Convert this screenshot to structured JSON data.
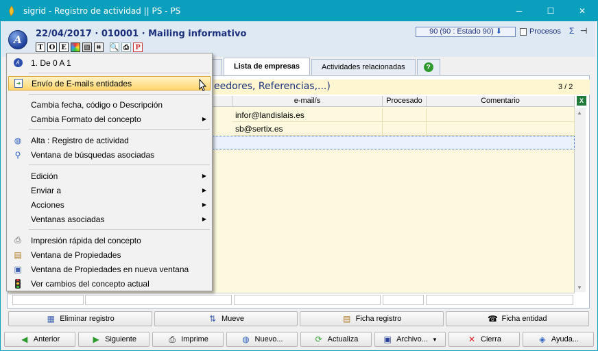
{
  "window": {
    "title": "sigrid - Registro de actividad || PS - PS",
    "controls": {
      "minimize": "─",
      "maximize": "☐",
      "close": "✕"
    }
  },
  "header": {
    "avatar_letter": "A",
    "title": "22/04/2017 · 010001 · Mailing informativo",
    "status": "90 (90 : Estado 90)",
    "procesos": "Procesos",
    "sigma": "Σ",
    "toolbar": [
      "T",
      "O",
      "E"
    ]
  },
  "tabs": [
    {
      "label": "Lista de empresas",
      "active": true
    },
    {
      "label": "Actividades relacionadas",
      "active": false
    },
    {
      "label": "?",
      "active": false
    }
  ],
  "section": {
    "title": "eedores, Referencias,...)",
    "pager": "3 / 2"
  },
  "table": {
    "columns": [
      "e-mail/s",
      "Procesado",
      "Comentario"
    ],
    "rows": [
      {
        "email": "infor@landislais.es",
        "procesado": "",
        "comentario": ""
      },
      {
        "email": "sb@sertix.es",
        "procesado": "",
        "comentario": ""
      }
    ]
  },
  "context_menu": {
    "items": [
      {
        "label": "1. De 0 A 1",
        "icon": "avatar-icon"
      },
      {
        "label": "Envío de E-mails entidades",
        "icon": "mail-send-icon",
        "highlighted": true
      },
      {
        "label": "Cambia fecha, código o Descripción"
      },
      {
        "label": "Cambia Formato del concepto",
        "submenu": true
      },
      {
        "label": "Alta : Registro de actividad",
        "icon": "globe-icon"
      },
      {
        "label": "Ventana de búsquedas asociadas",
        "icon": "search-icon"
      },
      {
        "label": "Edición",
        "submenu": true
      },
      {
        "label": "Enviar a",
        "submenu": true
      },
      {
        "label": "Acciones",
        "submenu": true
      },
      {
        "label": "Ventanas asociadas",
        "submenu": true
      },
      {
        "label": "Impresión rápida del concepto",
        "icon": "printer-icon"
      },
      {
        "label": "Ventana de Propiedades",
        "icon": "properties-icon"
      },
      {
        "label": "Ventana de Propiedades en nueva ventana",
        "icon": "properties-window-icon"
      },
      {
        "label": "Ver cambios del concepto actual",
        "icon": "traffic-light-icon"
      }
    ]
  },
  "action_buttons": {
    "eliminar": "Eliminar registro",
    "mueve": "Mueve",
    "ficha_registro": "Ficha registro",
    "ficha_entidad": "Ficha entidad"
  },
  "nav_buttons": {
    "anterior": "Anterior",
    "siguiente": "Siguiente",
    "imprime": "Imprime",
    "nuevo": "Nuevo...",
    "actualiza": "Actualiza",
    "archivo": "Archivo...",
    "cierra": "Cierra",
    "ayuda": "Ayuda..."
  }
}
